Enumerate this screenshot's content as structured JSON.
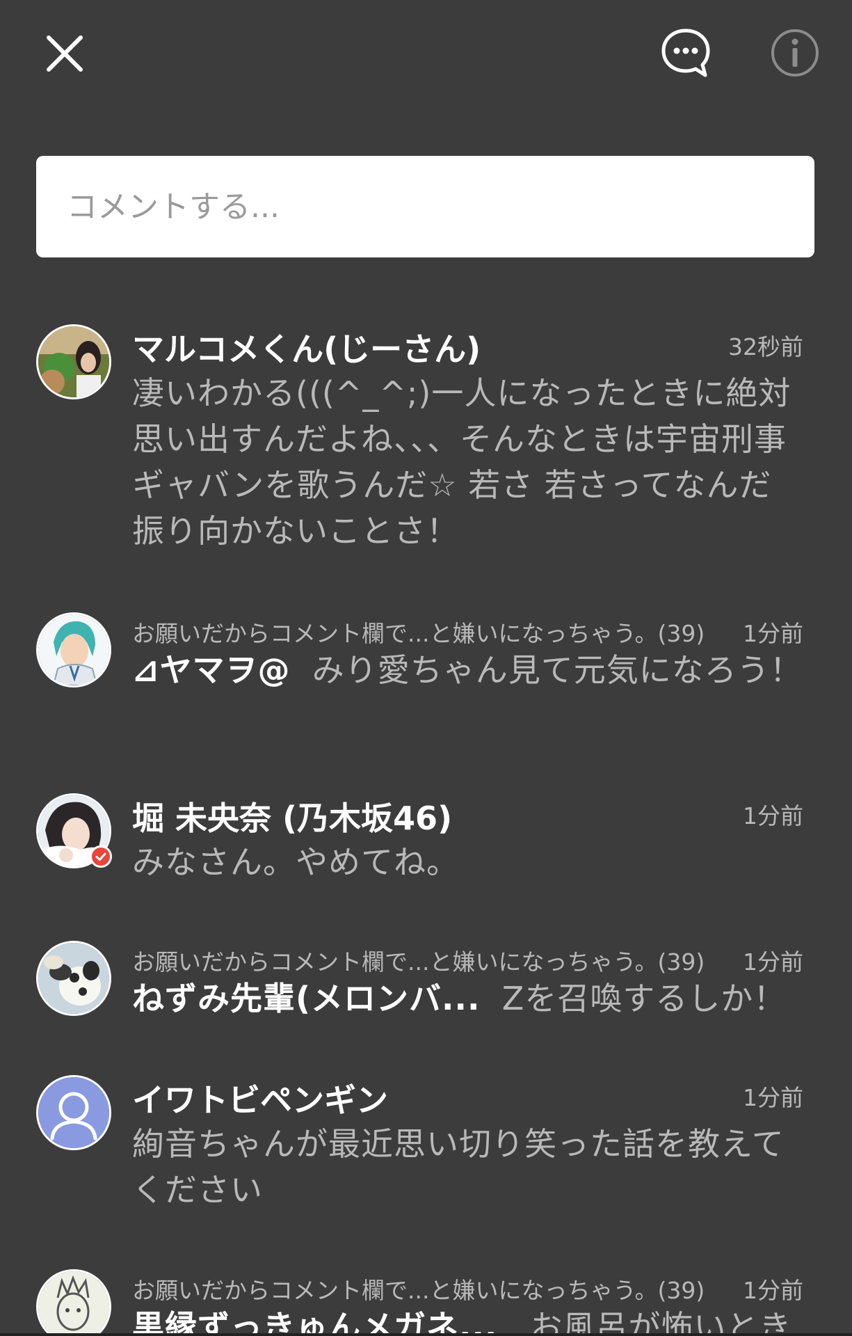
{
  "header": {
    "close_icon": "close-icon",
    "chat_icon": "chat-bubble-icon",
    "info_icon": "info-icon"
  },
  "comment_input": {
    "placeholder": "コメントする..."
  },
  "comments": [
    {
      "name": "マルコメくん(じーさん)",
      "time": "32秒前",
      "text": "凄いわかる(((^_^;)一人になったときに絶対思い出すんだよね、、、そんなときは宇宙刑事ギャバンを歌うんだ☆ 若さ 若さってなんだ 振り向かないことさ！"
    },
    {
      "reply_to": "お願いだからコメント欄で...と嫌いになっちゃう。(39)",
      "name": "⊿ヤマヲ@",
      "time": "1分前",
      "text": "みり愛ちゃん見て元気になろう！"
    },
    {
      "name": "堀 未央奈 (乃木坂46)",
      "time": "1分前",
      "text": "みなさん。やめてね。",
      "verified": true
    },
    {
      "reply_to": "お願いだからコメント欄で...と嫌いになっちゃう。(39)",
      "name": "ねずみ先輩(メロンバ...",
      "time": "1分前",
      "text": "Zを召喚するしか！"
    },
    {
      "name": "イワトビペンギン",
      "time": "1分前",
      "text": "絢音ちゃんが最近思い切り笑った話を教えてください"
    },
    {
      "reply_to": "お願いだからコメント欄で...と嫌いになっちゃう。(39)",
      "name": "黒縁ずっきゅんメガネ...",
      "time": "1分前",
      "text": "お風呂が怖いとき"
    }
  ],
  "colors": {
    "background": "#3c3c3c",
    "name": "#ffffff",
    "muted_text": "#b9b9b9",
    "verified_badge": "#e8453c",
    "default_avatar": "#8a9ae0"
  }
}
